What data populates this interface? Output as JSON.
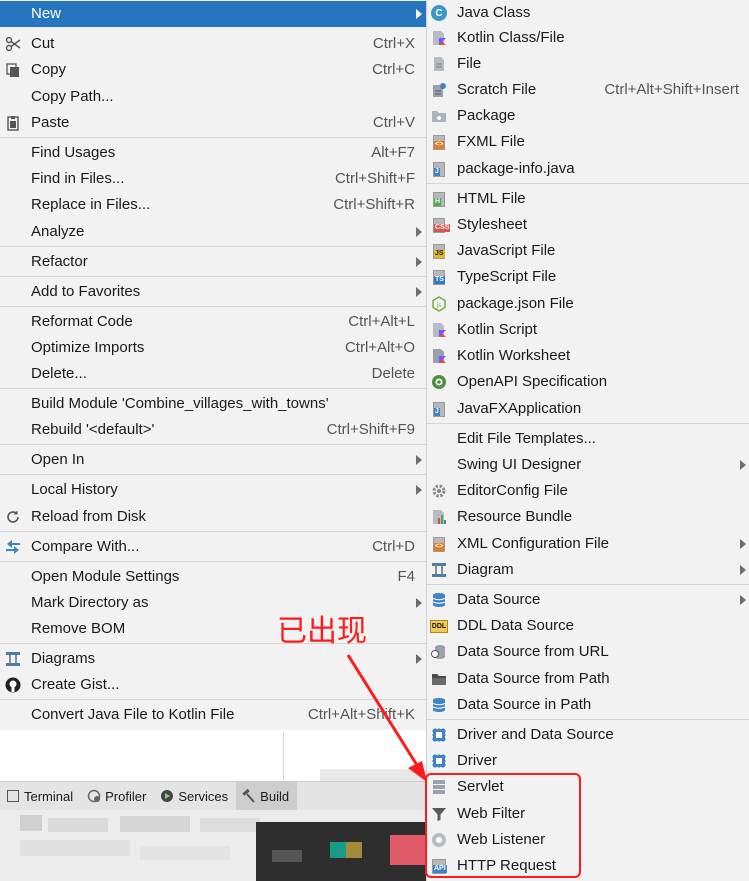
{
  "colors": {
    "selection": "#2675bf",
    "menu_bg": "#f2f2f2",
    "annotation": "#ff1b1b"
  },
  "left_menu": {
    "new": "New",
    "cut": "Cut",
    "cut_sc": "Ctrl+X",
    "copy": "Copy",
    "copy_sc": "Ctrl+C",
    "copy_path": "Copy Path...",
    "paste": "Paste",
    "paste_sc": "Ctrl+V",
    "find_usages": "Find Usages",
    "find_usages_sc": "Alt+F7",
    "find_in_files": "Find in Files...",
    "find_in_files_sc": "Ctrl+Shift+F",
    "replace_in_files": "Replace in Files...",
    "replace_in_files_sc": "Ctrl+Shift+R",
    "analyze": "Analyze",
    "refactor": "Refactor",
    "add_to_favorites": "Add to Favorites",
    "reformat_code": "Reformat Code",
    "reformat_code_sc": "Ctrl+Alt+L",
    "optimize_imports": "Optimize Imports",
    "optimize_imports_sc": "Ctrl+Alt+O",
    "delete": "Delete...",
    "delete_sc": "Delete",
    "build_module": "Build Module 'Combine_villages_with_towns'",
    "rebuild": "Rebuild '<default>'",
    "rebuild_sc": "Ctrl+Shift+F9",
    "open_in": "Open In",
    "local_history": "Local History",
    "reload_from_disk": "Reload from Disk",
    "compare_with": "Compare With...",
    "compare_with_sc": "Ctrl+D",
    "open_module_settings": "Open Module Settings",
    "open_module_settings_sc": "F4",
    "mark_directory_as": "Mark Directory as",
    "remove_bom": "Remove BOM",
    "diagrams": "Diagrams",
    "create_gist": "Create Gist...",
    "convert_java": "Convert Java File to Kotlin File",
    "convert_java_sc": "Ctrl+Alt+Shift+K"
  },
  "right_menu": {
    "java_class": "Java Class",
    "kotlin_class": "Kotlin Class/File",
    "file": "File",
    "scratch_file": "Scratch File",
    "scratch_file_sc": "Ctrl+Alt+Shift+Insert",
    "package": "Package",
    "fxml_file": "FXML File",
    "package_info": "package-info.java",
    "html_file": "HTML File",
    "stylesheet": "Stylesheet",
    "javascript_file": "JavaScript File",
    "typescript_file": "TypeScript File",
    "package_json": "package.json File",
    "kotlin_script": "Kotlin Script",
    "kotlin_worksheet": "Kotlin Worksheet",
    "openapi": "OpenAPI Specification",
    "javafx_app": "JavaFXApplication",
    "edit_file_templates": "Edit File Templates...",
    "swing_ui_designer": "Swing UI Designer",
    "editorconfig_file": "EditorConfig File",
    "resource_bundle": "Resource Bundle",
    "xml_config_file": "XML Configuration File",
    "diagram": "Diagram",
    "data_source": "Data Source",
    "ddl_data_source": "DDL Data Source",
    "data_source_url": "Data Source from URL",
    "data_source_path": "Data Source from Path",
    "data_source_in_path": "Data Source in Path",
    "driver_and_data_source": "Driver and Data Source",
    "driver": "Driver",
    "servlet": "Servlet",
    "web_filter": "Web Filter",
    "web_listener": "Web Listener",
    "http_request": "HTTP Request"
  },
  "toolbar": {
    "terminal": "Terminal",
    "profiler": "Profiler",
    "services": "Services",
    "build": "Build"
  },
  "annotation": {
    "text": "已出现"
  },
  "icon_marks": {
    "java_class": "C",
    "css": "CSS",
    "js": "JS",
    "ts": "TS",
    "html": "H",
    "java": "J",
    "xml": "<>",
    "ddl": "DDL",
    "api": "API"
  }
}
